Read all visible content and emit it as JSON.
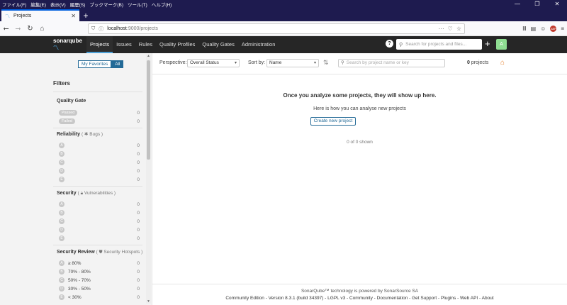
{
  "os_menu": [
    "ファイル(F)",
    "編集(E)",
    "表示(V)",
    "履歴(S)",
    "ブックマーク(B)",
    "ツール(T)",
    "ヘルプ(H)"
  ],
  "window_controls": [
    "—",
    "❐",
    "✕"
  ],
  "browser": {
    "tab_title": "Projects",
    "url_host": "localhost",
    "url_path": ":9000/projects"
  },
  "sonar": {
    "logo": "sonarqube",
    "nav": [
      "Projects",
      "Issues",
      "Rules",
      "Quality Profiles",
      "Quality Gates",
      "Administration"
    ],
    "search_placeholder": "Search for projects and files...",
    "avatar_letter": "A"
  },
  "sidebar": {
    "toggle": [
      "My Favorites",
      "All"
    ],
    "filters_title": "Filters",
    "quality_gate": {
      "title": "Quality Gate",
      "rows": [
        {
          "label": "Passed",
          "count": "0"
        },
        {
          "label": "Failed",
          "count": "0"
        }
      ]
    },
    "reliability": {
      "title": "Reliability",
      "sub": "Bugs",
      "rows": [
        {
          "label": "A",
          "count": "0"
        },
        {
          "label": "B",
          "count": "0"
        },
        {
          "label": "C",
          "count": "0"
        },
        {
          "label": "D",
          "count": "0"
        },
        {
          "label": "E",
          "count": "0"
        }
      ]
    },
    "security": {
      "title": "Security",
      "sub": "Vulnerabilities",
      "rows": [
        {
          "label": "A",
          "count": "0"
        },
        {
          "label": "B",
          "count": "0"
        },
        {
          "label": "C",
          "count": "0"
        },
        {
          "label": "D",
          "count": "0"
        },
        {
          "label": "E",
          "count": "0"
        }
      ]
    },
    "security_review": {
      "title": "Security Review",
      "sub": "Security Hotspots",
      "rows": [
        {
          "grade": "A",
          "label": "≥ 80%",
          "count": "0"
        },
        {
          "grade": "B",
          "label": "70% - 80%",
          "count": "0"
        },
        {
          "grade": "C",
          "label": "50% - 70%",
          "count": "0"
        },
        {
          "grade": "D",
          "label": "30% - 50%",
          "count": "0"
        },
        {
          "grade": "E",
          "label": "< 30%",
          "count": "0"
        }
      ]
    }
  },
  "toolbar": {
    "perspective_label": "Perspective:",
    "perspective_value": "Overall Status",
    "sort_label": "Sort by:",
    "sort_value": "Name",
    "search_placeholder": "Search by project name or key",
    "count_number": "0",
    "count_word": "projects"
  },
  "empty": {
    "title": "Once you analyze some projects, they will show up here.",
    "subtitle": "Here is how you can analyse new projects",
    "create_button": "Create new project",
    "shown": "0 of 0 shown"
  },
  "footer": {
    "line1": "SonarQube™ technology is powered by SonarSource SA",
    "line2": "Community Edition - Version 8.3.1 (build 34397) - LGPL v3 - Community - Documentation - Get Support - Plugins - Web API - About"
  }
}
